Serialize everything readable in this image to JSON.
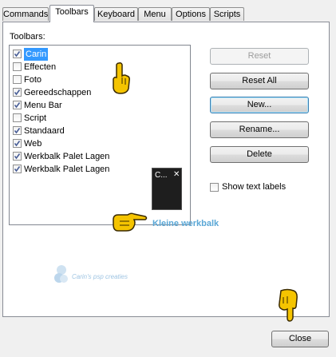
{
  "tabs": [
    {
      "label": "Commands",
      "active": false
    },
    {
      "label": "Toolbars",
      "active": true
    },
    {
      "label": "Keyboard",
      "active": false
    },
    {
      "label": "Menu",
      "active": false
    },
    {
      "label": "Options",
      "active": false
    },
    {
      "label": "Scripts",
      "active": false
    }
  ],
  "toolbars_label": "Toolbars:",
  "toolbars": [
    {
      "label": "Carin",
      "checked": true,
      "selected": true
    },
    {
      "label": "Effecten",
      "checked": false,
      "selected": false
    },
    {
      "label": "Foto",
      "checked": false,
      "selected": false
    },
    {
      "label": "Gereedschappen",
      "checked": true,
      "selected": false
    },
    {
      "label": "Menu Bar",
      "checked": true,
      "selected": false
    },
    {
      "label": "Script",
      "checked": false,
      "selected": false
    },
    {
      "label": "Standaard",
      "checked": true,
      "selected": false
    },
    {
      "label": "Web",
      "checked": true,
      "selected": false
    },
    {
      "label": "Werkbalk Palet Lagen",
      "checked": true,
      "selected": false
    },
    {
      "label": "Werkbalk Palet Lagen",
      "checked": true,
      "selected": false
    }
  ],
  "buttons": {
    "reset": "Reset",
    "reset_all": "Reset All",
    "new": "New...",
    "rename": "Rename...",
    "delete": "Delete",
    "close": "Close"
  },
  "show_text_labels": {
    "label": "Show text labels",
    "checked": false
  },
  "mini_toolbar": {
    "title": "C...",
    "close": "✕"
  },
  "annotation": {
    "text": "Kleine werkbalk",
    "color": "#5aa7d6"
  },
  "watermark": {
    "text": "Carin's psp creaties",
    "color": "#9ec4e2"
  },
  "colors": {
    "selection": "#3399ff",
    "hand": "#f5c400"
  }
}
